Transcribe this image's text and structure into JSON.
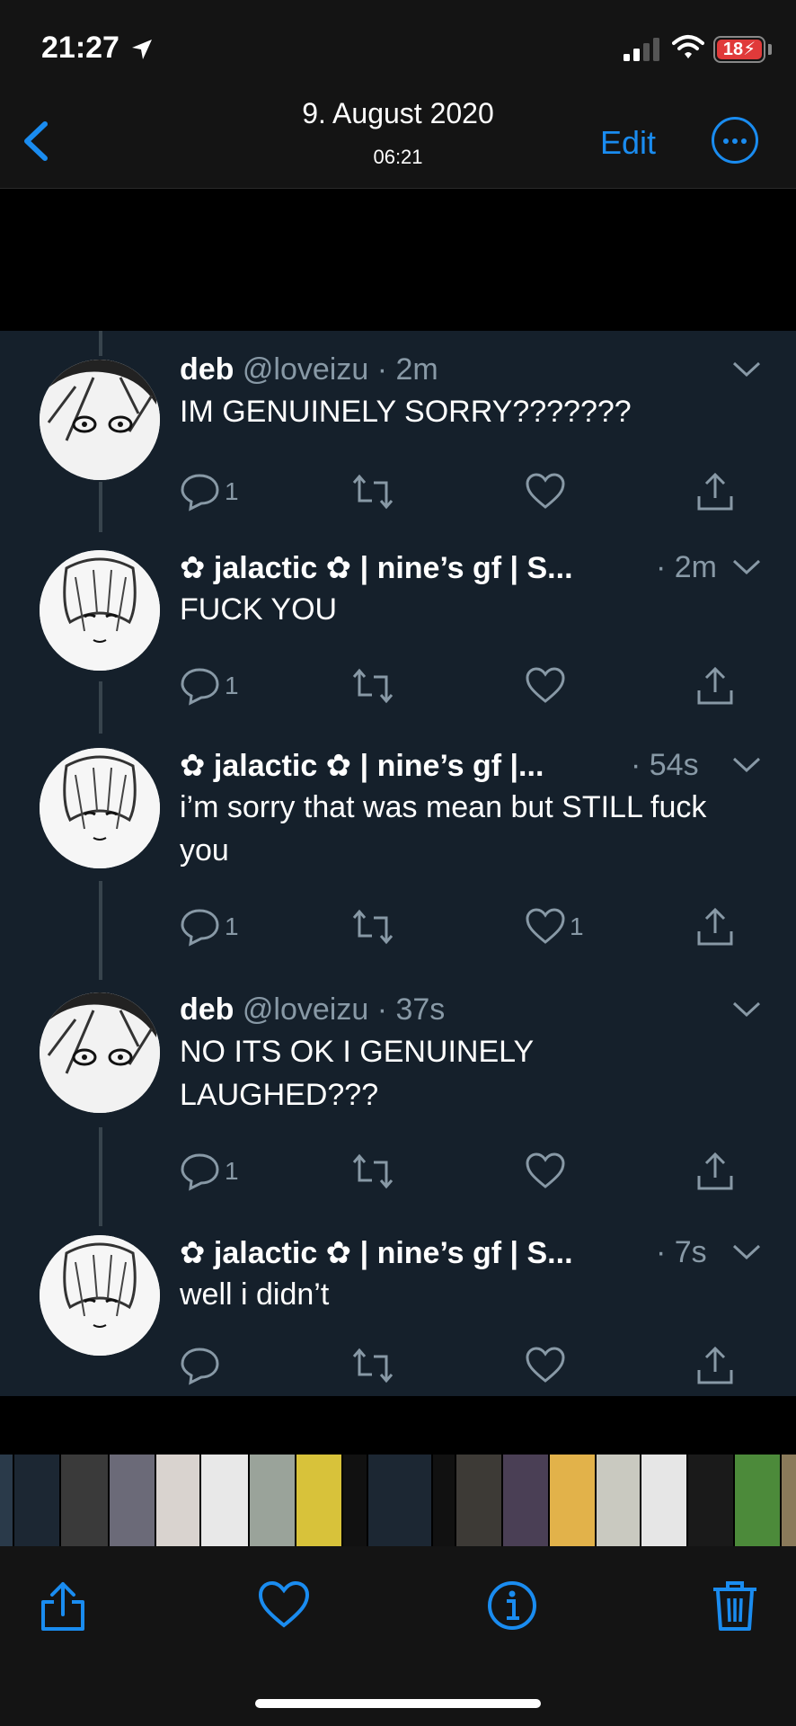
{
  "status_bar": {
    "time": "21:27",
    "battery": "18"
  },
  "nav": {
    "date": "9. August 2020",
    "time": "06:21",
    "edit_label": "Edit"
  },
  "tweets": [
    {
      "name": "deb",
      "meta": "@loveizu · 2m",
      "time": "",
      "text": "IM GENUINELY SORRY???????",
      "replies": "1",
      "likes": ""
    },
    {
      "name": "✿ jalactic ✿ | nine’s gf | S...",
      "meta": "",
      "time": "· 2m",
      "text": "FUCK YOU",
      "replies": "1",
      "likes": ""
    },
    {
      "name": "✿ jalactic ✿ | nine’s gf |...",
      "meta": "",
      "time": "· 54s",
      "text": "i’m sorry that was mean but STILL fuck you",
      "replies": "1",
      "likes": "1"
    },
    {
      "name": "deb",
      "meta": "@loveizu · 37s",
      "time": "",
      "text": "NO ITS OK I GENUINELY LAUGHED???",
      "replies": "1",
      "likes": ""
    },
    {
      "name": "✿ jalactic ✿ | nine’s gf | S...",
      "meta": "",
      "time": "· 7s",
      "text": "well i didn’t",
      "replies": "",
      "likes": ""
    }
  ],
  "colors": {
    "accent": "#1a8cf0",
    "tweet_bg": "#15202b",
    "muted": "#8899a6",
    "battery_low": "#e03a3a"
  },
  "icons": {
    "reply": "reply-icon",
    "retweet": "retweet-icon",
    "like": "heart-icon",
    "share": "share-icon",
    "caret": "chevron-down-icon"
  }
}
